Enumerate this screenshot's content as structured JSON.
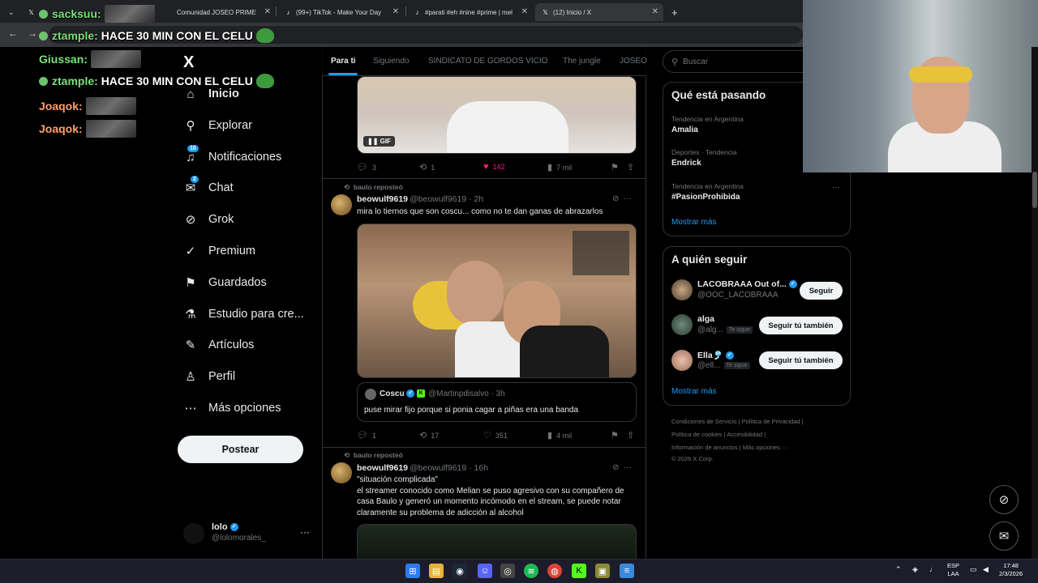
{
  "browser": {
    "tabs": [
      {
        "label": "Comunidad JOSEO PRIME",
        "icon": "x-icon"
      },
      {
        "label": "(99+) TikTok - Make Your Day",
        "icon": "tiktok-icon"
      },
      {
        "label": "#parati #eh #nine #prime | mel",
        "icon": "tiktok-icon"
      },
      {
        "label": "(12) Inicio / X",
        "icon": "x-icon"
      }
    ],
    "new_tab": "+"
  },
  "chat_overlay": [
    {
      "user": "sacksuu:",
      "text": ""
    },
    {
      "user": "ztample:",
      "text": "HACE 30 MIN CON EL CELU"
    },
    {
      "user": "Giussan:",
      "text": ""
    },
    {
      "user": "ztample:",
      "text": "HACE 30 MIN CON EL CELU"
    },
    {
      "user": "Joaqok:",
      "text": ""
    },
    {
      "user": "Joaqok:",
      "text": ""
    }
  ],
  "nav": {
    "logo": "X",
    "items": [
      {
        "label": "Inicio",
        "icon": "home-icon",
        "badge": ""
      },
      {
        "label": "Explorar",
        "icon": "search-icon",
        "badge": ""
      },
      {
        "label": "Notificaciones",
        "icon": "bell-icon",
        "badge": "10"
      },
      {
        "label": "Chat",
        "icon": "mail-icon",
        "badge": "2"
      },
      {
        "label": "Grok",
        "icon": "grok-icon",
        "badge": ""
      },
      {
        "label": "Premium",
        "icon": "verified-icon",
        "badge": ""
      },
      {
        "label": "Guardados",
        "icon": "bookmark-icon",
        "badge": ""
      },
      {
        "label": "Estudio para cre...",
        "icon": "flask-icon",
        "badge": ""
      },
      {
        "label": "Artículos",
        "icon": "article-icon",
        "badge": ""
      },
      {
        "label": "Perfil",
        "icon": "person-icon",
        "badge": ""
      },
      {
        "label": "Más opciones",
        "icon": "more-circle-icon",
        "badge": ""
      }
    ],
    "post_button": "Postear",
    "account": {
      "name": "lolo",
      "handle": "@lolomorales_"
    }
  },
  "feed": {
    "tabs": [
      "Para ti",
      "Siguiendo",
      "SINDICATO DE GORDOS VICIO",
      "The jungle",
      "JOSEO"
    ],
    "first_post_actions": {
      "replies": "3",
      "reposts": "1",
      "likes": "142",
      "views": "7 mil",
      "gif_label": "GIF"
    },
    "posts": [
      {
        "reposted_by": "baulo reposteó",
        "name": "beowulf9619",
        "handle": "@beowulf9619",
        "time": "· 2h",
        "text": "mira lo tiernos que son coscu... como no te dan ganas de abrazarlos",
        "quote": {
          "name": "Coscu",
          "handle": "@Martinpdisalvo",
          "time": "· 3h",
          "text": "puse mirar fijo porque si ponia cagar a piñas era una banda"
        },
        "actions": {
          "replies": "1",
          "reposts": "17",
          "likes": "351",
          "views": "4 mil"
        }
      },
      {
        "reposted_by": "baulo reposteó",
        "name": "beowulf9619",
        "handle": "@beowulf9619",
        "time": "· 16h",
        "text_lines": [
          "\"situación complicada\"",
          "el streamer conocido como Melian se puso agresivo con su compañero de",
          "casa Baulo y generó un momento incómodo en el stream, se puede notar",
          "claramente su problema de adicción al alcohol"
        ]
      }
    ]
  },
  "sidebar": {
    "search_placeholder": "Buscar",
    "trends_title": "Qué está pasando",
    "trends": [
      {
        "meta": "Tendencia en Argentina",
        "topic": "Amalia"
      },
      {
        "meta": "Deportes · Tendencia",
        "topic": "Endrick"
      },
      {
        "meta": "Tendencia en Argentina",
        "topic": "#PasionProhibida"
      }
    ],
    "trends_more": "Mostrar más",
    "follow_title": "A quién seguir",
    "follow": [
      {
        "name": "LACOBRAAA Out of...",
        "handle": "@OOC_LACOBRAAA",
        "follows_you": "",
        "button": "Seguir"
      },
      {
        "name": "alga",
        "handle": "@alg...",
        "follows_you": "Te sigue",
        "button": "Seguir tú también"
      },
      {
        "name": "Ella🎐",
        "handle": "@ell...",
        "follows_you": "Te sigue",
        "button": "Seguir tú también"
      }
    ],
    "follow_more": "Mostrar más",
    "footer": [
      "Condiciones de Servicio  |  Política de Privacidad  |",
      "Política de cookies  |  Accesibilidad  |",
      "Información de anuncios  |  Más opciones ···",
      "© 2026 X Corp."
    ]
  },
  "taskbar": {
    "lang": "ESP",
    "lang2": "LAA",
    "time": "17:48",
    "date": "2/3/2026"
  },
  "colors": {
    "accent": "#1d9bf0",
    "like": "#f91880",
    "background": "#000000"
  }
}
